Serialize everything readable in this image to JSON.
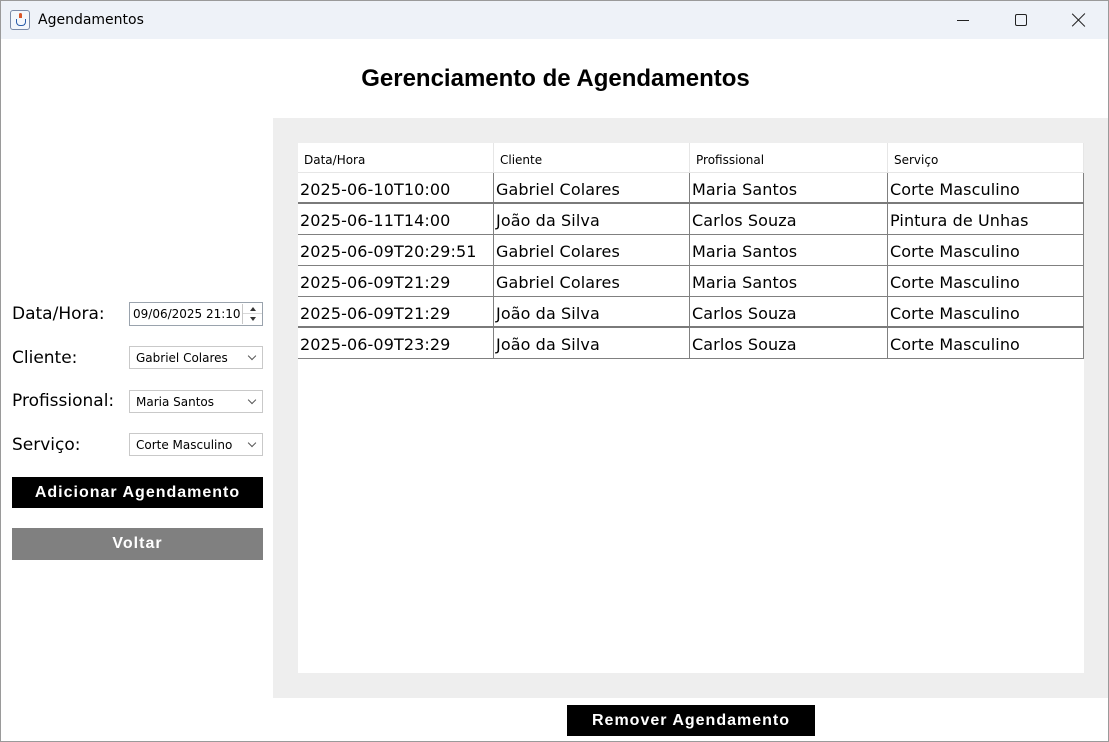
{
  "window": {
    "title": "Agendamentos"
  },
  "page": {
    "title": "Gerenciamento de Agendamentos"
  },
  "form": {
    "date_label": "Data/Hora:",
    "date_value": "09/06/2025 21:10",
    "client_label": "Cliente:",
    "client_value": "Gabriel Colares",
    "professional_label": "Profissional:",
    "professional_value": "Maria Santos",
    "service_label": "Serviço:",
    "service_value": "Corte Masculino",
    "add_button": "Adicionar Agendamento",
    "back_button": "Voltar"
  },
  "table": {
    "columns": [
      "Data/Hora",
      "Cliente",
      "Profissional",
      "Serviço"
    ],
    "rows": [
      [
        "2025-06-10T10:00",
        "Gabriel Colares",
        "Maria Santos",
        "Corte Masculino"
      ],
      [
        "2025-06-11T14:00",
        "João da Silva",
        "Carlos Souza",
        "Pintura de Unhas"
      ],
      [
        "2025-06-09T20:29:51",
        "Gabriel Colares",
        "Maria Santos",
        "Corte Masculino"
      ],
      [
        "2025-06-09T21:29",
        "Gabriel Colares",
        "Maria Santos",
        "Corte Masculino"
      ],
      [
        "2025-06-09T21:29",
        "João da Silva",
        "Carlos Souza",
        "Corte Masculino"
      ],
      [
        "2025-06-09T23:29",
        "João da Silva",
        "Carlos Souza",
        "Corte Masculino"
      ]
    ]
  },
  "actions": {
    "remove_button": "Remover Agendamento"
  },
  "colors": {
    "primary_button": "#000000",
    "secondary_button": "#808080",
    "panel_background": "#eeeeee"
  },
  "icons": {
    "app": "java-cup-icon",
    "minimize": "minimize-icon",
    "maximize": "maximize-icon",
    "close": "close-icon"
  }
}
